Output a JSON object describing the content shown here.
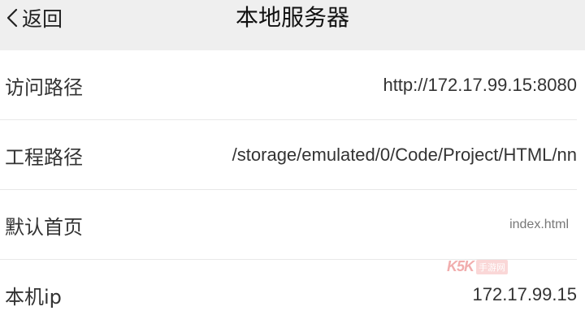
{
  "nav": {
    "back_label": "返回",
    "title": "本地服务器"
  },
  "rows": [
    {
      "label": "访问路径",
      "value": "http://172.17.99.15:8080"
    },
    {
      "label": "工程路径",
      "value": "/storage/emulated/0/Code/Project/HTML/nn"
    },
    {
      "label": "默认首页",
      "value": "index.html"
    },
    {
      "label": "本机ip",
      "value": "172.17.99.15"
    }
  ],
  "watermark": {
    "brand": "K5K",
    "suffix": "手游网"
  },
  "colors": {
    "nav_background": "#efefef",
    "watermark": "#e66b6b"
  }
}
